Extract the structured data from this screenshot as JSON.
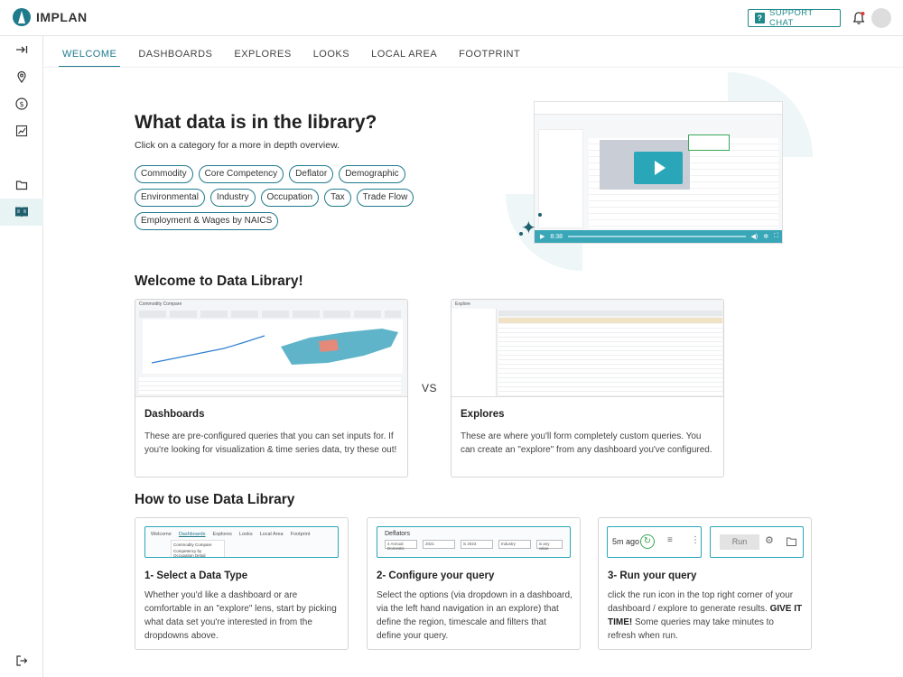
{
  "app": {
    "name": "IMPLAN",
    "support_label": "SUPPORT CHAT"
  },
  "tabs": [
    "WELCOME",
    "DASHBOARDS",
    "EXPLORES",
    "LOOKS",
    "LOCAL AREA",
    "FOOTPRINT"
  ],
  "active_tab": "WELCOME",
  "library": {
    "title": "What data is in the library?",
    "subtitle": "Click on a category for a more in depth overview.",
    "categories": [
      "Commodity",
      "Core Competency",
      "Deflator",
      "Demographic",
      "Environmental",
      "Industry",
      "Occupation",
      "Tax",
      "Trade Flow",
      "Employment & Wages by NAICS"
    ]
  },
  "video": {
    "time": "8:38"
  },
  "welcome": {
    "title": "Welcome to Data Library!",
    "vs": "VS",
    "dashboards": {
      "title": "Dashboards",
      "text": "These are pre-configured queries that you can set inputs for. If you're looking for visualization & time series data, try these out!",
      "shot_title": "Commodity Compare"
    },
    "explores": {
      "title": "Explores",
      "text": "These are where you'll form completely custom queries. You can create an \"explore\" from any dashboard you've configured.",
      "shot_title": "Explore"
    }
  },
  "howto": {
    "title": "How to use Data Library",
    "steps": [
      {
        "title": "1- Select a Data Type",
        "text": "Whether you'd like a dashboard or are comfortable in an \"explore\" lens, start by picking what data set you're interested in from the dropdowns above."
      },
      {
        "title": "2- Configure your query",
        "text": "Select the options (via dropdown in a dashboard, via the left hand navigation in an explore) that define the region, timescale and filters that define your query."
      },
      {
        "title": "3- Run your query",
        "text_before": "click the run icon in the top right corner of your dashboard / explore to generate results.",
        "text_bold": "GIVE IT TIME!",
        "text_after": "Some queries may take minutes to refresh when run."
      }
    ],
    "mini1": {
      "tabs": [
        "Welcome",
        "Dashboards",
        "Explores",
        "Looks",
        "Local Area",
        "Footprint"
      ],
      "items": [
        "Commodity Compare",
        "Competency by Occupation Detail"
      ]
    },
    "mini2": {
      "title": "Deflators",
      "fields": [
        "4 Annual Domestic",
        "2021",
        "is 2023",
        "Industry",
        "is any value"
      ]
    },
    "mini3": {
      "ago": "5m ago",
      "run": "Run"
    }
  }
}
